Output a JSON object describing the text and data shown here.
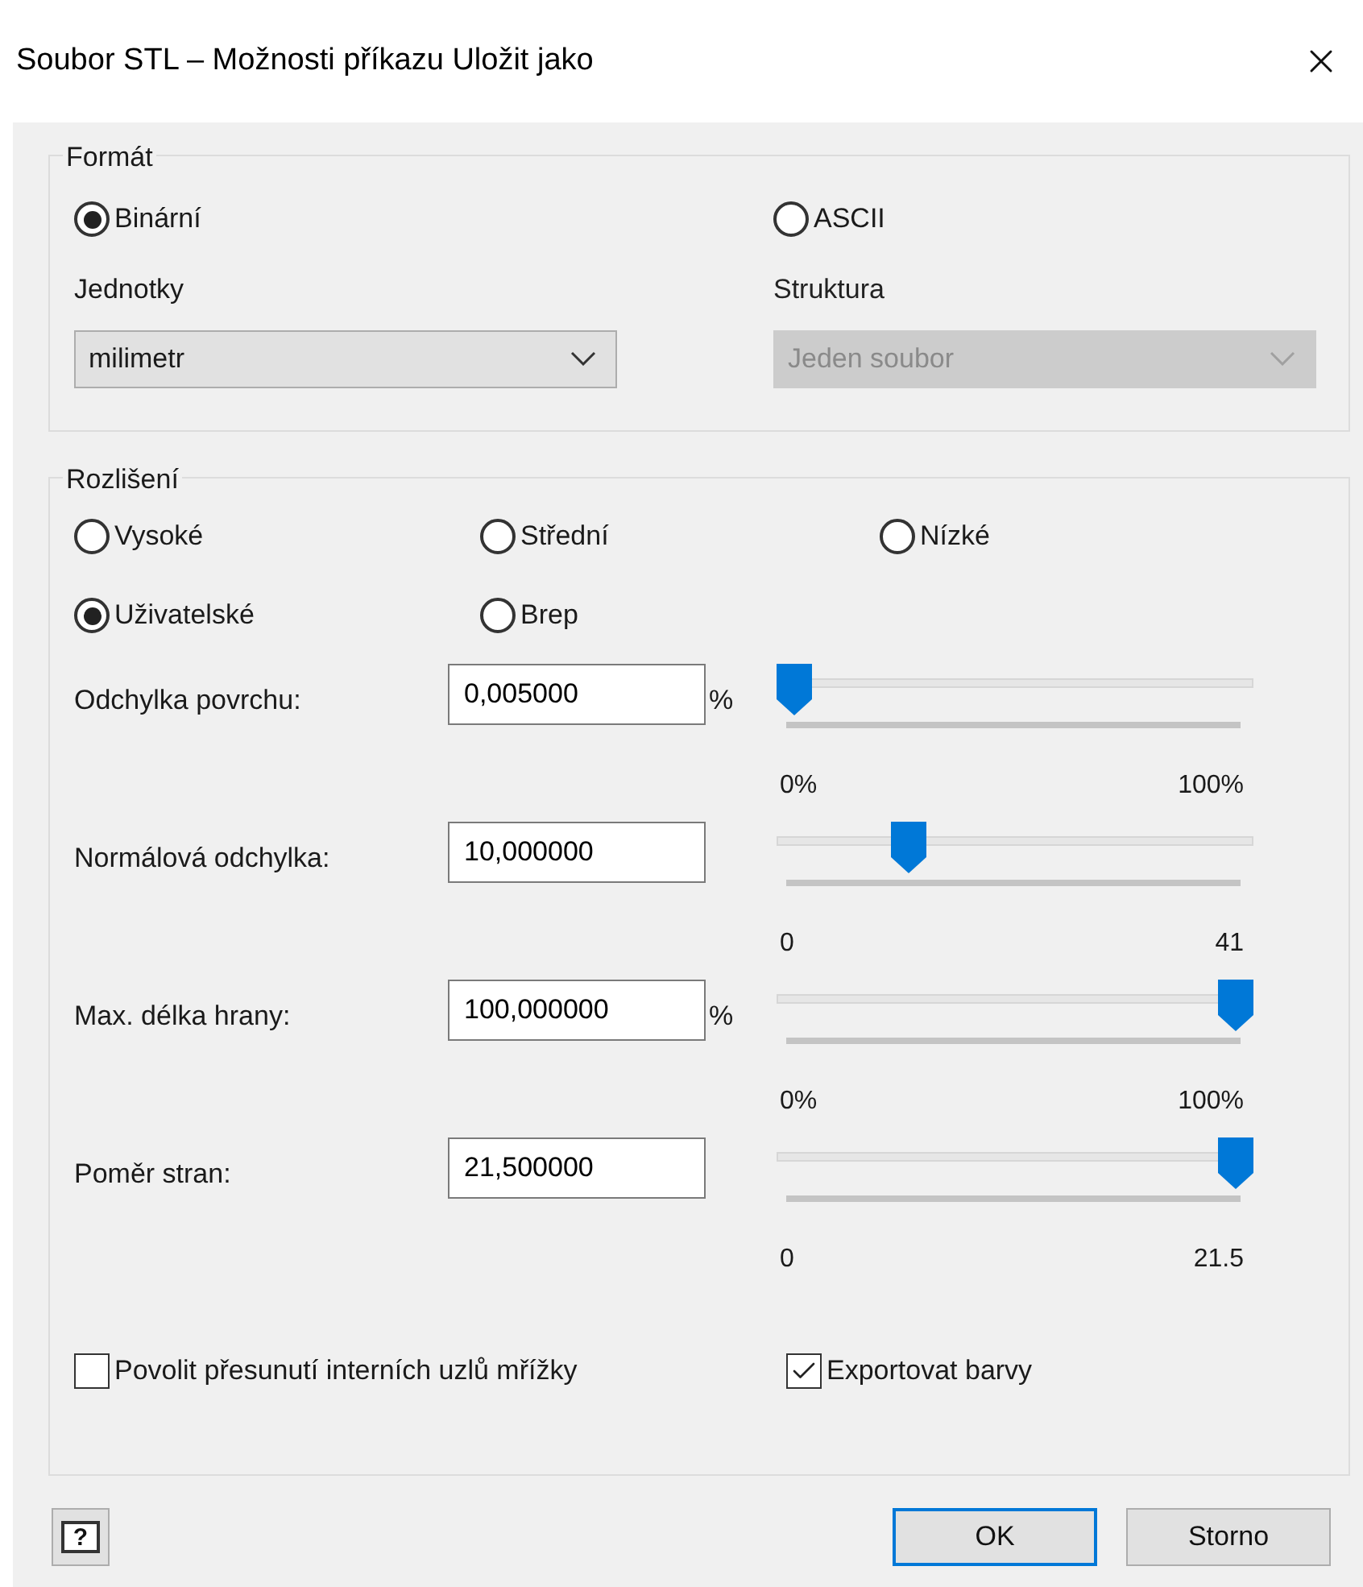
{
  "window": {
    "title": "Soubor STL – Možnosti příkazu Uložit jako"
  },
  "format": {
    "legend": "Formát",
    "options": [
      {
        "label": "Binární",
        "selected": true
      },
      {
        "label": "ASCII",
        "selected": false
      }
    ],
    "units": {
      "label": "Jednotky",
      "value": "milimetr",
      "disabled": false
    },
    "structure": {
      "label": "Struktura",
      "value": "Jeden soubor",
      "disabled": true
    }
  },
  "resolution": {
    "legend": "Rozlišení",
    "options": [
      {
        "label": "Vysoké",
        "selected": false
      },
      {
        "label": "Střední",
        "selected": false
      },
      {
        "label": "Nízké",
        "selected": false
      },
      {
        "label": "Uživatelské",
        "selected": true
      },
      {
        "label": "Brep",
        "selected": false
      }
    ],
    "parameters": [
      {
        "label": "Odchylka povrchu:",
        "value": "0,005000",
        "unit": "%",
        "level": 0,
        "min": "0%",
        "max": "100%"
      },
      {
        "label": "Normálová odchylka:",
        "value": "10,000000",
        "level": 0.26,
        "min": "0",
        "max": "41"
      },
      {
        "label": "Max. délka hrany:",
        "value": "100,000000",
        "unit": "%",
        "level": 1,
        "min": "0%",
        "max": "100%"
      },
      {
        "label": "Poměr stran:",
        "value": "21,500000",
        "level": 1,
        "min": "0",
        "max": "21.5"
      }
    ],
    "checkboxes": [
      {
        "label": "Povolit přesunutí interních uzlů mřížky",
        "checked": false
      },
      {
        "label": "Exportovat barvy",
        "checked": true
      }
    ]
  },
  "buttons": {
    "help": "?",
    "actions": [
      {
        "label": "OK",
        "default": true
      },
      {
        "label": "Storno",
        "default": false
      }
    ]
  }
}
